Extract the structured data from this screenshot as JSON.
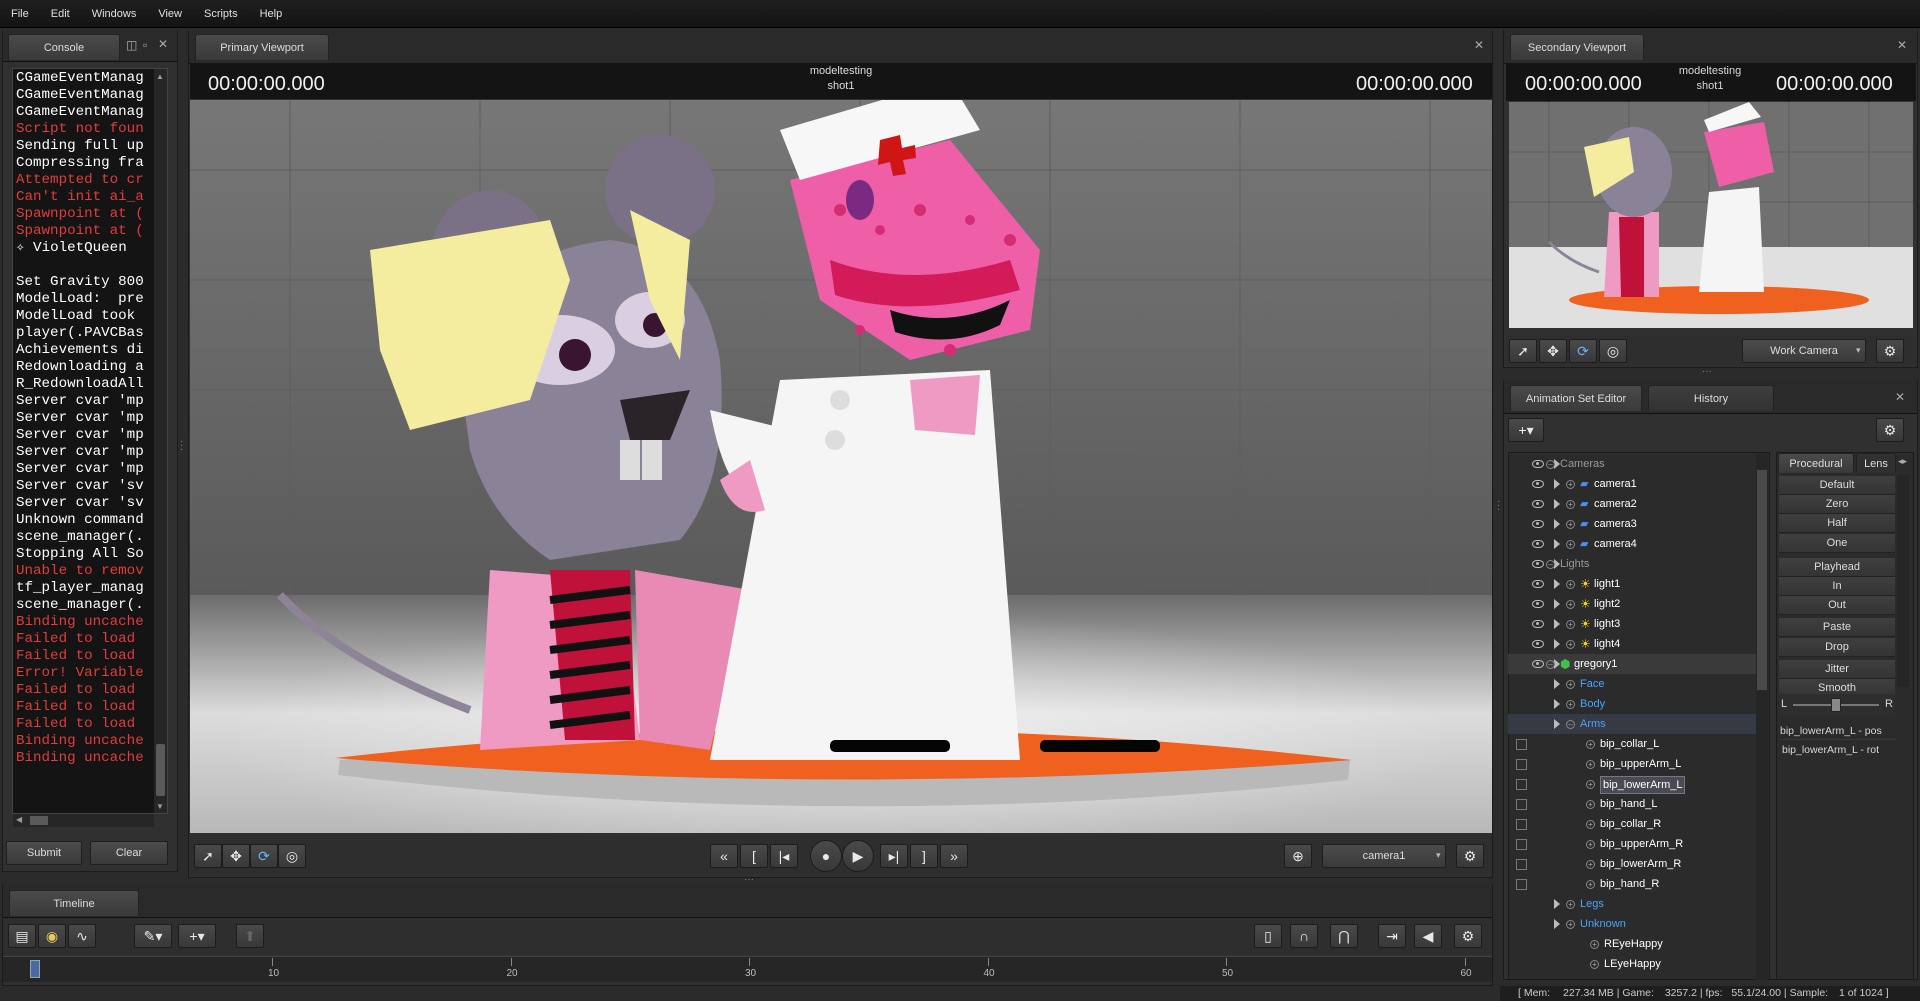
{
  "menu": [
    "File",
    "Edit",
    "Windows",
    "View",
    "Scripts",
    "Help"
  ],
  "console": {
    "tab_label": "Console",
    "lines": [
      {
        "text": "CGameEventManag",
        "color": "#ffffff"
      },
      {
        "text": "CGameEventManag",
        "color": "#ffffff"
      },
      {
        "text": "CGameEventManag",
        "color": "#ffffff"
      },
      {
        "text": "Script not foun",
        "color": "#e23c3c"
      },
      {
        "text": "Sending full up",
        "color": "#ffffff"
      },
      {
        "text": "Compressing fra",
        "color": "#ffffff"
      },
      {
        "text": "Attempted to cr",
        "color": "#e23c3c"
      },
      {
        "text": "Can't init ai_a",
        "color": "#e23c3c"
      },
      {
        "text": "Spawnpoint at (",
        "color": "#e23c3c"
      },
      {
        "text": "Spawnpoint at (",
        "color": "#e23c3c"
      },
      {
        "text": "✧ VioletQueen",
        "color": "#ffffff"
      },
      {
        "text": "",
        "color": "#ffffff"
      },
      {
        "text": "Set Gravity 800",
        "color": "#ffffff"
      },
      {
        "text": "ModelLoad:  pre",
        "color": "#ffffff"
      },
      {
        "text": "ModelLoad took",
        "color": "#ffffff"
      },
      {
        "text": "player(.PAVCBas",
        "color": "#ffffff"
      },
      {
        "text": "Achievements di",
        "color": "#ffffff"
      },
      {
        "text": "Redownloading a",
        "color": "#ffffff"
      },
      {
        "text": "R_RedownloadAll",
        "color": "#ffffff"
      },
      {
        "text": "Server cvar 'mp",
        "color": "#ffffff"
      },
      {
        "text": "Server cvar 'mp",
        "color": "#ffffff"
      },
      {
        "text": "Server cvar 'mp",
        "color": "#ffffff"
      },
      {
        "text": "Server cvar 'mp",
        "color": "#ffffff"
      },
      {
        "text": "Server cvar 'mp",
        "color": "#ffffff"
      },
      {
        "text": "Server cvar 'sv",
        "color": "#ffffff"
      },
      {
        "text": "Server cvar 'sv",
        "color": "#ffffff"
      },
      {
        "text": "Unknown command",
        "color": "#ffffff"
      },
      {
        "text": "scene_manager(.",
        "color": "#ffffff"
      },
      {
        "text": "Stopping All So",
        "color": "#ffffff"
      },
      {
        "text": "Unable to remov",
        "color": "#e23c3c"
      },
      {
        "text": "tf_player_manag",
        "color": "#ffffff"
      },
      {
        "text": "scene_manager(.",
        "color": "#ffffff"
      },
      {
        "text": "Binding uncache",
        "color": "#e23c3c"
      },
      {
        "text": "Failed to load",
        "color": "#e23c3c"
      },
      {
        "text": "Failed to load",
        "color": "#e23c3c"
      },
      {
        "text": "Error! Variable",
        "color": "#e23c3c"
      },
      {
        "text": "Failed to load",
        "color": "#e23c3c"
      },
      {
        "text": "Failed to load",
        "color": "#e23c3c"
      },
      {
        "text": "Failed to load",
        "color": "#e23c3c"
      },
      {
        "text": "Binding uncache",
        "color": "#e23c3c"
      },
      {
        "text": "Binding uncache",
        "color": "#e23c3c"
      }
    ],
    "submit_label": "Submit",
    "clear_label": "Clear"
  },
  "primary_viewport": {
    "tab_label": "Primary Viewport",
    "time_left": "00:00:00.000",
    "time_right": "00:00:00.000",
    "session": "modeltesting",
    "shot": "shot1",
    "camera_select": "camera1"
  },
  "secondary_viewport": {
    "tab_label": "Secondary Viewport",
    "time_left": "00:00:00.000",
    "time_right": "00:00:00.000",
    "session": "modeltesting",
    "shot": "shot1",
    "camera_select": "Work Camera"
  },
  "animation_set_editor": {
    "tab_label": "Animation Set Editor",
    "history_tab_label": "History",
    "tree": [
      {
        "label": "Cameras",
        "type": "group",
        "eye": true,
        "color": "#9a9a9a"
      },
      {
        "label": "camera1",
        "type": "camera",
        "eye": true,
        "color": "#ffffff"
      },
      {
        "label": "camera2",
        "type": "camera",
        "eye": true,
        "color": "#ffffff"
      },
      {
        "label": "camera3",
        "type": "camera",
        "eye": true,
        "color": "#ffffff"
      },
      {
        "label": "camera4",
        "type": "camera",
        "eye": true,
        "color": "#ffffff"
      },
      {
        "label": "Lights",
        "type": "group",
        "eye": true,
        "color": "#9a9a9a"
      },
      {
        "label": "light1",
        "type": "light",
        "eye": true,
        "color": "#ffffff"
      },
      {
        "label": "light2",
        "type": "light",
        "eye": true,
        "color": "#ffffff"
      },
      {
        "label": "light3",
        "type": "light",
        "eye": true,
        "color": "#ffffff"
      },
      {
        "label": "light4",
        "type": "light",
        "eye": true,
        "color": "#ffffff"
      },
      {
        "label": "gregory1",
        "type": "model",
        "eye": true,
        "color": "#ffffff"
      },
      {
        "label": "Face",
        "type": "sub",
        "eye": false,
        "color": "#4aa3ff"
      },
      {
        "label": "Body",
        "type": "sub",
        "eye": false,
        "color": "#4aa3ff"
      },
      {
        "label": "Arms",
        "type": "sub",
        "eye": false,
        "color": "#4aa3ff"
      },
      {
        "label": "bip_collar_L",
        "type": "bone",
        "eye": false,
        "color": "#ffffff"
      },
      {
        "label": "bip_upperArm_L",
        "type": "bone",
        "eye": false,
        "color": "#ffffff"
      },
      {
        "label": "bip_lowerArm_L",
        "type": "bone",
        "eye": false,
        "color": "#ffffff"
      },
      {
        "label": "bip_hand_L",
        "type": "bone",
        "eye": false,
        "color": "#ffffff"
      },
      {
        "label": "bip_collar_R",
        "type": "bone",
        "eye": false,
        "color": "#ffffff"
      },
      {
        "label": "bip_upperArm_R",
        "type": "bone",
        "eye": false,
        "color": "#ffffff"
      },
      {
        "label": "bip_lowerArm_R",
        "type": "bone",
        "eye": false,
        "color": "#ffffff"
      },
      {
        "label": "bip_hand_R",
        "type": "bone",
        "eye": false,
        "color": "#ffffff"
      },
      {
        "label": "Legs",
        "type": "sub",
        "eye": false,
        "color": "#4aa3ff"
      },
      {
        "label": "Unknown",
        "type": "sub",
        "eye": false,
        "color": "#4aa3ff"
      },
      {
        "label": "REyeHappy",
        "type": "flex",
        "eye": false,
        "color": "#ffffff"
      },
      {
        "label": "LEyeHappy",
        "type": "flex",
        "eye": false,
        "color": "#ffffff"
      }
    ],
    "presets_tab": "Procedural",
    "lens_tab": "Lens",
    "presets": [
      "Default",
      "Zero",
      "Half",
      "One",
      "Playhead",
      "In",
      "Out",
      "Paste",
      "Drop",
      "Jitter",
      "Smooth"
    ],
    "slider_left": "L",
    "slider_right": "R",
    "slider_balance": 0.5,
    "controls": [
      "bip_lowerArm_L - pos",
      "bip_lowerArm_L - rot"
    ]
  },
  "timeline": {
    "tab_label": "Timeline",
    "ruler_labels": [
      "10",
      "20",
      "30",
      "40",
      "50",
      "60"
    ]
  },
  "status": {
    "mem_label": "[ Mem:",
    "mem_value": "227.34 MB",
    "game_label": "| Game:",
    "game_value": "3257.2",
    "fps_label": "| fps:",
    "fps_value": "55.1/24.00",
    "sample_label": "| Sample:",
    "sample_value": "1 of 1024 ]"
  },
  "colors": {
    "accent": "#4aa3ff",
    "error": "#e23c3c",
    "orange_stage": "#f0601e"
  }
}
